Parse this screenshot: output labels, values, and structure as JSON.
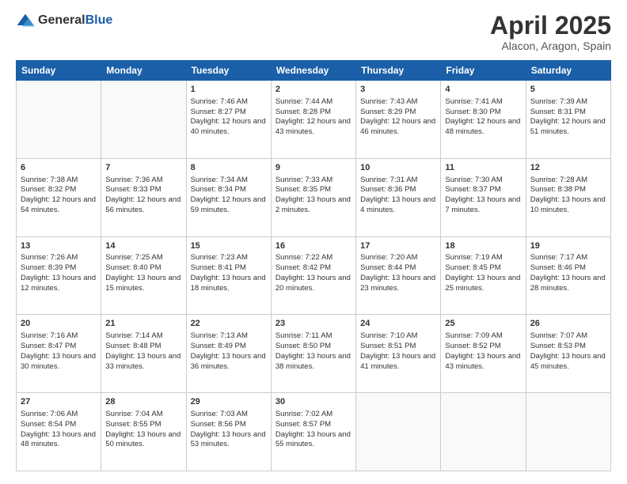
{
  "logo": {
    "general": "General",
    "blue": "Blue"
  },
  "header": {
    "month": "April 2025",
    "location": "Alacon, Aragon, Spain"
  },
  "days_of_week": [
    "Sunday",
    "Monday",
    "Tuesday",
    "Wednesday",
    "Thursday",
    "Friday",
    "Saturday"
  ],
  "weeks": [
    [
      {
        "day": "",
        "info": ""
      },
      {
        "day": "",
        "info": ""
      },
      {
        "day": "1",
        "info": "Sunrise: 7:46 AM\nSunset: 8:27 PM\nDaylight: 12 hours and 40 minutes."
      },
      {
        "day": "2",
        "info": "Sunrise: 7:44 AM\nSunset: 8:28 PM\nDaylight: 12 hours and 43 minutes."
      },
      {
        "day": "3",
        "info": "Sunrise: 7:43 AM\nSunset: 8:29 PM\nDaylight: 12 hours and 46 minutes."
      },
      {
        "day": "4",
        "info": "Sunrise: 7:41 AM\nSunset: 8:30 PM\nDaylight: 12 hours and 48 minutes."
      },
      {
        "day": "5",
        "info": "Sunrise: 7:39 AM\nSunset: 8:31 PM\nDaylight: 12 hours and 51 minutes."
      }
    ],
    [
      {
        "day": "6",
        "info": "Sunrise: 7:38 AM\nSunset: 8:32 PM\nDaylight: 12 hours and 54 minutes."
      },
      {
        "day": "7",
        "info": "Sunrise: 7:36 AM\nSunset: 8:33 PM\nDaylight: 12 hours and 56 minutes."
      },
      {
        "day": "8",
        "info": "Sunrise: 7:34 AM\nSunset: 8:34 PM\nDaylight: 12 hours and 59 minutes."
      },
      {
        "day": "9",
        "info": "Sunrise: 7:33 AM\nSunset: 8:35 PM\nDaylight: 13 hours and 2 minutes."
      },
      {
        "day": "10",
        "info": "Sunrise: 7:31 AM\nSunset: 8:36 PM\nDaylight: 13 hours and 4 minutes."
      },
      {
        "day": "11",
        "info": "Sunrise: 7:30 AM\nSunset: 8:37 PM\nDaylight: 13 hours and 7 minutes."
      },
      {
        "day": "12",
        "info": "Sunrise: 7:28 AM\nSunset: 8:38 PM\nDaylight: 13 hours and 10 minutes."
      }
    ],
    [
      {
        "day": "13",
        "info": "Sunrise: 7:26 AM\nSunset: 8:39 PM\nDaylight: 13 hours and 12 minutes."
      },
      {
        "day": "14",
        "info": "Sunrise: 7:25 AM\nSunset: 8:40 PM\nDaylight: 13 hours and 15 minutes."
      },
      {
        "day": "15",
        "info": "Sunrise: 7:23 AM\nSunset: 8:41 PM\nDaylight: 13 hours and 18 minutes."
      },
      {
        "day": "16",
        "info": "Sunrise: 7:22 AM\nSunset: 8:42 PM\nDaylight: 13 hours and 20 minutes."
      },
      {
        "day": "17",
        "info": "Sunrise: 7:20 AM\nSunset: 8:44 PM\nDaylight: 13 hours and 23 minutes."
      },
      {
        "day": "18",
        "info": "Sunrise: 7:19 AM\nSunset: 8:45 PM\nDaylight: 13 hours and 25 minutes."
      },
      {
        "day": "19",
        "info": "Sunrise: 7:17 AM\nSunset: 8:46 PM\nDaylight: 13 hours and 28 minutes."
      }
    ],
    [
      {
        "day": "20",
        "info": "Sunrise: 7:16 AM\nSunset: 8:47 PM\nDaylight: 13 hours and 30 minutes."
      },
      {
        "day": "21",
        "info": "Sunrise: 7:14 AM\nSunset: 8:48 PM\nDaylight: 13 hours and 33 minutes."
      },
      {
        "day": "22",
        "info": "Sunrise: 7:13 AM\nSunset: 8:49 PM\nDaylight: 13 hours and 36 minutes."
      },
      {
        "day": "23",
        "info": "Sunrise: 7:11 AM\nSunset: 8:50 PM\nDaylight: 13 hours and 38 minutes."
      },
      {
        "day": "24",
        "info": "Sunrise: 7:10 AM\nSunset: 8:51 PM\nDaylight: 13 hours and 41 minutes."
      },
      {
        "day": "25",
        "info": "Sunrise: 7:09 AM\nSunset: 8:52 PM\nDaylight: 13 hours and 43 minutes."
      },
      {
        "day": "26",
        "info": "Sunrise: 7:07 AM\nSunset: 8:53 PM\nDaylight: 13 hours and 45 minutes."
      }
    ],
    [
      {
        "day": "27",
        "info": "Sunrise: 7:06 AM\nSunset: 8:54 PM\nDaylight: 13 hours and 48 minutes."
      },
      {
        "day": "28",
        "info": "Sunrise: 7:04 AM\nSunset: 8:55 PM\nDaylight: 13 hours and 50 minutes."
      },
      {
        "day": "29",
        "info": "Sunrise: 7:03 AM\nSunset: 8:56 PM\nDaylight: 13 hours and 53 minutes."
      },
      {
        "day": "30",
        "info": "Sunrise: 7:02 AM\nSunset: 8:57 PM\nDaylight: 13 hours and 55 minutes."
      },
      {
        "day": "",
        "info": ""
      },
      {
        "day": "",
        "info": ""
      },
      {
        "day": "",
        "info": ""
      }
    ]
  ]
}
